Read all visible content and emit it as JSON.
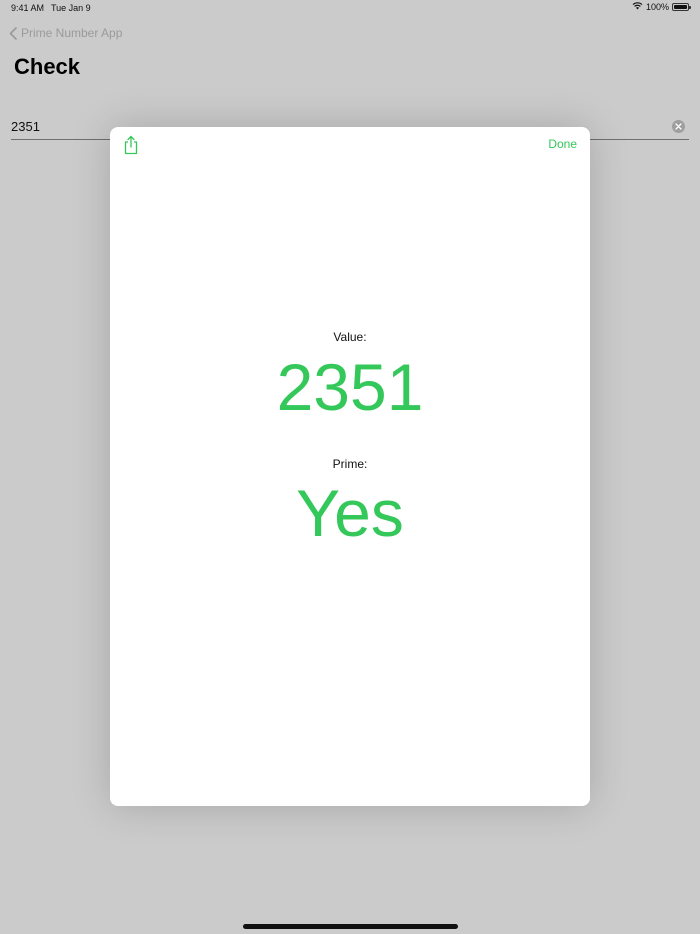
{
  "status_bar": {
    "time": "9:41 AM",
    "date": "Tue Jan 9",
    "battery_percent": "100%",
    "icons": [
      "wifi-icon",
      "battery-icon"
    ]
  },
  "nav": {
    "back_label": "Prime Number App",
    "title": "Check"
  },
  "input": {
    "value": "2351"
  },
  "sheet": {
    "done_label": "Done",
    "value_label": "Value:",
    "value": "2351",
    "prime_label": "Prime:",
    "prime_answer": "Yes"
  },
  "colors": {
    "accent": "#34c759",
    "background": "#cbcbcb",
    "sheet": "#ffffff"
  }
}
